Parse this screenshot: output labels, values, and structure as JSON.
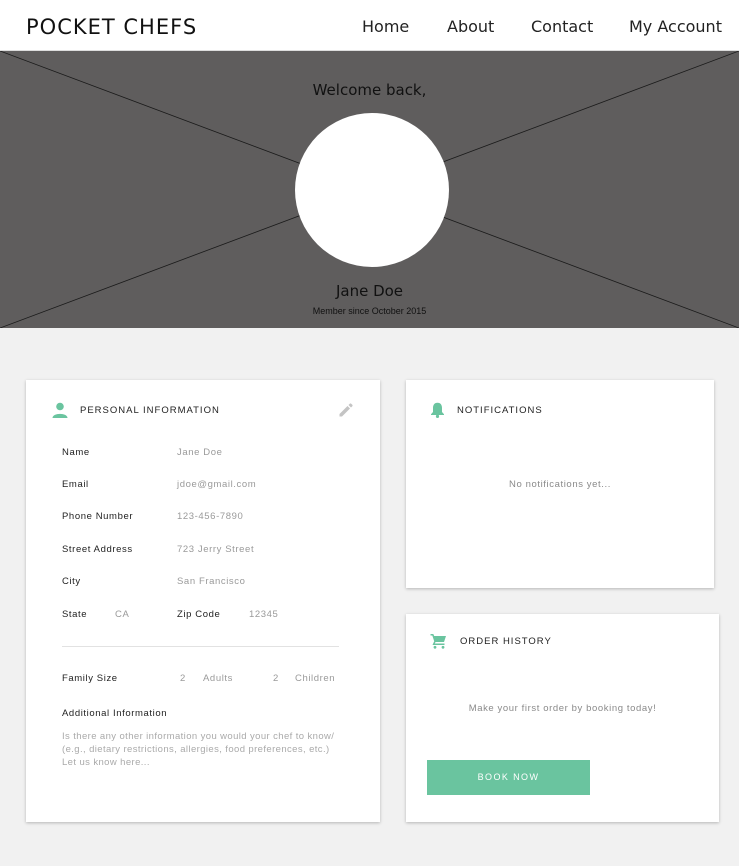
{
  "brand": "POCKET CHEFS",
  "nav": {
    "home": "Home",
    "about": "About",
    "contact": "Contact",
    "account": "My Account"
  },
  "hero": {
    "welcome": "Welcome back,",
    "name": "Jane Doe",
    "member_since": "Member since October 2015"
  },
  "personal": {
    "title": "PERSONAL INFORMATION",
    "name_label": "Name",
    "name_value": "Jane Doe",
    "email_label": "Email",
    "email_value": "jdoe@gmail.com",
    "phone_label": "Phone Number",
    "phone_value": "123-456-7890",
    "street_label": "Street Address",
    "street_value": "723 Jerry Street",
    "city_label": "City",
    "city_value": "San Francisco",
    "state_label": "State",
    "state_value": "CA",
    "zip_label": "Zip Code",
    "zip_value": "12345",
    "family_label": "Family Size",
    "adults_count": "2",
    "adults_label": "Adults",
    "children_count": "2",
    "children_label": "Children",
    "additional_label": "Additional Information",
    "additional_placeholder": "Is there any other information you would your chef to know/ (e.g., dietary restrictions, allergies, food preferences, etc.) Let us know here..."
  },
  "notifications": {
    "title": "NOTIFICATIONS",
    "empty": "No notifications yet..."
  },
  "orders": {
    "title": "ORDER HISTORY",
    "empty": "Make your first order by booking today!",
    "button": "BOOK NOW"
  },
  "colors": {
    "accent": "#6ac49f",
    "hero_bg": "#5f5d5d",
    "page_bg": "#f1f1f1"
  },
  "icons": {
    "personal": "person-icon",
    "edit": "pencil-icon",
    "notifications": "bell-icon",
    "orders": "cart-icon"
  }
}
